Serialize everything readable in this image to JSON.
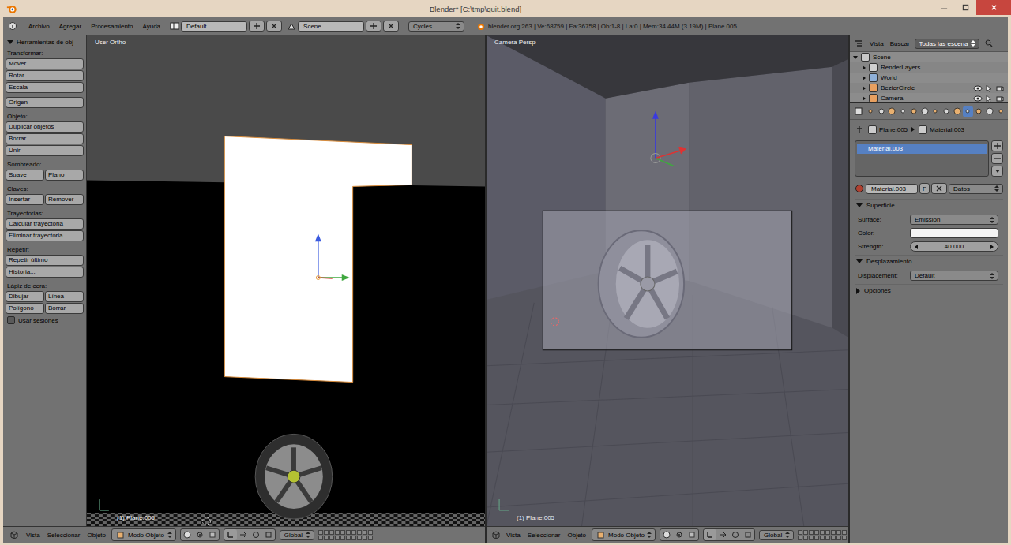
{
  "window": {
    "title": "Blender* [C:\\tmp\\quit.blend]"
  },
  "info_header": {
    "menus": [
      "Archivo",
      "Agregar",
      "Procesamiento",
      "Ayuda"
    ],
    "layout": "Default",
    "scene": "Scene",
    "engine": "Cycles",
    "stats": "blender.org 263 | Ve:68759 | Fa:36758 | Ob:1-8 | La:0 | Mem:34.44M (3.19M) | Plane.005"
  },
  "tool_shelf": {
    "title": "Herramientas de obj",
    "expanded": true,
    "sections": [
      {
        "title": "Transformar:",
        "rows": [
          [
            "Mover"
          ],
          [
            "Rotar"
          ],
          [
            "Escala"
          ]
        ]
      },
      {
        "title": null,
        "rows": [
          [
            "Origen"
          ]
        ]
      },
      {
        "title": "Objeto:",
        "rows": [
          [
            "Duplicar objetos"
          ],
          [
            "Borrar"
          ],
          [
            "Unir"
          ]
        ]
      },
      {
        "title": "Sombreado:",
        "rows": [
          [
            "Suave",
            "Plano"
          ]
        ]
      },
      {
        "title": "Claves:",
        "rows": [
          [
            "Insertar",
            "Remover"
          ]
        ]
      },
      {
        "title": "Trayectorias:",
        "rows": [
          [
            "Calcular trayectoria"
          ],
          [
            "Eliminar trayectoria"
          ]
        ]
      },
      {
        "title": "Repetir:",
        "rows": [
          [
            "Repetir último"
          ],
          [
            "Historia..."
          ]
        ]
      },
      {
        "title": "Lápiz de cera:",
        "rows": [
          [
            "Dibujar",
            "Línea"
          ],
          [
            "Polígono",
            "Borrar"
          ]
        ],
        "checkbox": {
          "label": "Usar sesiones",
          "checked": false
        }
      }
    ]
  },
  "viewports": [
    {
      "label": "User Ortho",
      "footer": "(1) Plane.005",
      "kind": "ortho"
    },
    {
      "label": "Camera Persp",
      "footer": "(1) Plane.005",
      "kind": "camera"
    }
  ],
  "viewport_header": {
    "menus": [
      "Vista",
      "Seleccionar",
      "Objeto"
    ],
    "mode": "Modo Objeto",
    "orientation": "Global"
  },
  "outliner": {
    "menus": [
      "Vista",
      "Buscar"
    ],
    "filter": "Todas las escena",
    "items": [
      {
        "name": "Scene",
        "depth": 0,
        "expanded": true,
        "toggles": false,
        "color": "#c8c8c8"
      },
      {
        "name": "RenderLayers",
        "depth": 1,
        "expanded": false,
        "toggles": false,
        "color": "#d0d0d0"
      },
      {
        "name": "World",
        "depth": 1,
        "expanded": false,
        "toggles": false,
        "color": "#8fb0d8"
      },
      {
        "name": "BezierCircle",
        "depth": 1,
        "expanded": false,
        "toggles": true,
        "color": "#e8a060"
      },
      {
        "name": "Camera",
        "depth": 1,
        "expanded": false,
        "toggles": true,
        "color": "#e8a060"
      }
    ]
  },
  "properties": {
    "tabs": [
      {
        "selected": false
      },
      {
        "selected": false
      },
      {
        "selected": false
      },
      {
        "selected": false
      },
      {
        "selected": false
      },
      {
        "selected": false
      },
      {
        "selected": false
      },
      {
        "selected": false
      },
      {
        "selected": false
      },
      {
        "selected": true
      },
      {
        "selected": false
      },
      {
        "selected": false
      },
      {
        "selected": false
      }
    ],
    "breadcrumb": [
      "Plane.005",
      "Material.003"
    ],
    "slots": [
      {
        "name": "Material.003",
        "selected": true
      }
    ],
    "material": "Material.003",
    "fake_user": "F",
    "link": "Datos",
    "panels": [
      {
        "title": "Superficie",
        "expanded": true,
        "rows": [
          {
            "label": "Surface:",
            "kind": "dropdown",
            "value": "Emission"
          },
          {
            "label": "Color:",
            "kind": "color",
            "color": "#f4f4f4"
          },
          {
            "label": "Strength:",
            "kind": "number",
            "value": "40.000"
          }
        ]
      },
      {
        "title": "Desplazamiento",
        "expanded": true,
        "rows": [
          {
            "label": "Displacement:",
            "kind": "dropdown",
            "value": "Default"
          }
        ]
      },
      {
        "title": "Opciones",
        "expanded": false,
        "rows": []
      }
    ]
  }
}
